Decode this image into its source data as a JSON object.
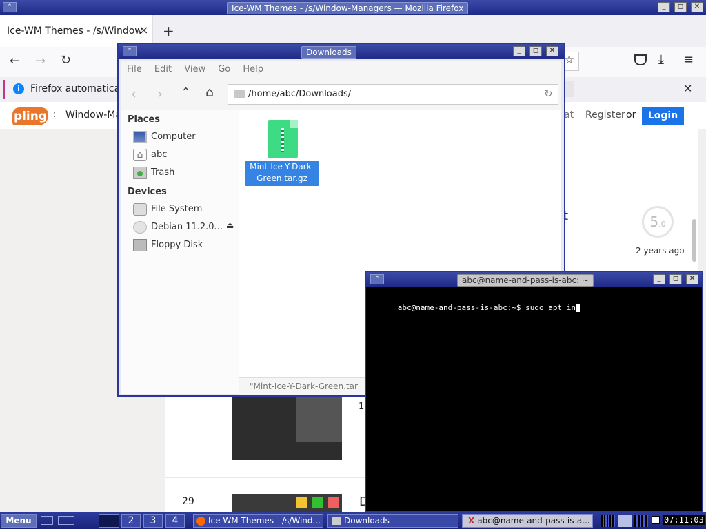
{
  "firefox": {
    "window_title": "Ice-WM Themes - /s/Window-Managers — Mozilla Firefox",
    "tab_title": "Ice-WM Themes - /s/Window",
    "tab_close": "×",
    "new_tab": "+",
    "notice_text": "Firefox automatical",
    "notice_close": "✕"
  },
  "pling": {
    "logo": "pling",
    "breadcrumb": "Window-Ma",
    "partial_word": "at",
    "register": "Register",
    "or": "or",
    "login": "Login",
    "rating": "5",
    "rating_decimal": ".0",
    "time_ago": "2 years ago",
    "partial_char": "t",
    "row_num_1": "1",
    "row_num_29": "29",
    "partial_d": "D"
  },
  "thunar": {
    "title": "Downloads",
    "menu": [
      "File",
      "Edit",
      "View",
      "Go",
      "Help"
    ],
    "path": "/home/abc/Downloads/",
    "places_header": "Places",
    "places": [
      "Computer",
      "abc",
      "Trash"
    ],
    "devices_header": "Devices",
    "devices": [
      "File System",
      "Debian 11.2.0...",
      "Floppy Disk"
    ],
    "file_line1": "Mint-Ice-Y-Dark-",
    "file_line2": "Green.tar.gz",
    "status": "\"Mint-Ice-Y-Dark-Green.tar"
  },
  "terminal": {
    "title": "abc@name-and-pass-is-abc: ~",
    "prompt": "abc@name-and-pass-is-abc:~$ sudo apt in"
  },
  "taskbar": {
    "menu": "Menu",
    "workspaces": [
      "2",
      "3",
      "4"
    ],
    "task_firefox": "Ice-WM Themes - /s/Wind...",
    "task_downloads": "Downloads",
    "task_terminal": "abc@name-and-pass-is-a...",
    "clock": "07:11:03"
  },
  "colors": {
    "accent": "#1e2a86",
    "login": "#1a73e8",
    "zip": "#3ddc84"
  }
}
